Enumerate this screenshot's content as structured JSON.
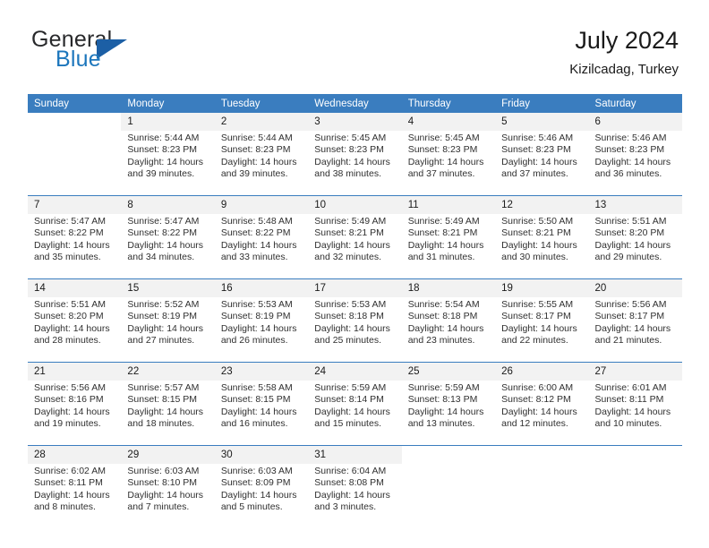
{
  "brand": {
    "word_one": "General",
    "word_two": "Blue",
    "logo_icon": "blue-triangle-icon"
  },
  "header": {
    "title": "July 2024",
    "subtitle": "Kizilcadag, Turkey"
  },
  "colors": {
    "header_blue": "#3a7dbf",
    "brand_blue": "#1c76bc",
    "logo_triangle": "#1c5fa5",
    "daynum_bg": "#f2f2f2",
    "text": "#1a1a1a"
  },
  "weekday_headers": [
    "Sunday",
    "Monday",
    "Tuesday",
    "Wednesday",
    "Thursday",
    "Friday",
    "Saturday"
  ],
  "weeks": [
    {
      "days": [
        {
          "num": "",
          "lines": []
        },
        {
          "num": "1",
          "lines": [
            "Sunrise: 5:44 AM",
            "Sunset: 8:23 PM",
            "Daylight: 14 hours",
            "and 39 minutes."
          ]
        },
        {
          "num": "2",
          "lines": [
            "Sunrise: 5:44 AM",
            "Sunset: 8:23 PM",
            "Daylight: 14 hours",
            "and 39 minutes."
          ]
        },
        {
          "num": "3",
          "lines": [
            "Sunrise: 5:45 AM",
            "Sunset: 8:23 PM",
            "Daylight: 14 hours",
            "and 38 minutes."
          ]
        },
        {
          "num": "4",
          "lines": [
            "Sunrise: 5:45 AM",
            "Sunset: 8:23 PM",
            "Daylight: 14 hours",
            "and 37 minutes."
          ]
        },
        {
          "num": "5",
          "lines": [
            "Sunrise: 5:46 AM",
            "Sunset: 8:23 PM",
            "Daylight: 14 hours",
            "and 37 minutes."
          ]
        },
        {
          "num": "6",
          "lines": [
            "Sunrise: 5:46 AM",
            "Sunset: 8:23 PM",
            "Daylight: 14 hours",
            "and 36 minutes."
          ]
        }
      ]
    },
    {
      "days": [
        {
          "num": "7",
          "lines": [
            "Sunrise: 5:47 AM",
            "Sunset: 8:22 PM",
            "Daylight: 14 hours",
            "and 35 minutes."
          ]
        },
        {
          "num": "8",
          "lines": [
            "Sunrise: 5:47 AM",
            "Sunset: 8:22 PM",
            "Daylight: 14 hours",
            "and 34 minutes."
          ]
        },
        {
          "num": "9",
          "lines": [
            "Sunrise: 5:48 AM",
            "Sunset: 8:22 PM",
            "Daylight: 14 hours",
            "and 33 minutes."
          ]
        },
        {
          "num": "10",
          "lines": [
            "Sunrise: 5:49 AM",
            "Sunset: 8:21 PM",
            "Daylight: 14 hours",
            "and 32 minutes."
          ]
        },
        {
          "num": "11",
          "lines": [
            "Sunrise: 5:49 AM",
            "Sunset: 8:21 PM",
            "Daylight: 14 hours",
            "and 31 minutes."
          ]
        },
        {
          "num": "12",
          "lines": [
            "Sunrise: 5:50 AM",
            "Sunset: 8:21 PM",
            "Daylight: 14 hours",
            "and 30 minutes."
          ]
        },
        {
          "num": "13",
          "lines": [
            "Sunrise: 5:51 AM",
            "Sunset: 8:20 PM",
            "Daylight: 14 hours",
            "and 29 minutes."
          ]
        }
      ]
    },
    {
      "days": [
        {
          "num": "14",
          "lines": [
            "Sunrise: 5:51 AM",
            "Sunset: 8:20 PM",
            "Daylight: 14 hours",
            "and 28 minutes."
          ]
        },
        {
          "num": "15",
          "lines": [
            "Sunrise: 5:52 AM",
            "Sunset: 8:19 PM",
            "Daylight: 14 hours",
            "and 27 minutes."
          ]
        },
        {
          "num": "16",
          "lines": [
            "Sunrise: 5:53 AM",
            "Sunset: 8:19 PM",
            "Daylight: 14 hours",
            "and 26 minutes."
          ]
        },
        {
          "num": "17",
          "lines": [
            "Sunrise: 5:53 AM",
            "Sunset: 8:18 PM",
            "Daylight: 14 hours",
            "and 25 minutes."
          ]
        },
        {
          "num": "18",
          "lines": [
            "Sunrise: 5:54 AM",
            "Sunset: 8:18 PM",
            "Daylight: 14 hours",
            "and 23 minutes."
          ]
        },
        {
          "num": "19",
          "lines": [
            "Sunrise: 5:55 AM",
            "Sunset: 8:17 PM",
            "Daylight: 14 hours",
            "and 22 minutes."
          ]
        },
        {
          "num": "20",
          "lines": [
            "Sunrise: 5:56 AM",
            "Sunset: 8:17 PM",
            "Daylight: 14 hours",
            "and 21 minutes."
          ]
        }
      ]
    },
    {
      "days": [
        {
          "num": "21",
          "lines": [
            "Sunrise: 5:56 AM",
            "Sunset: 8:16 PM",
            "Daylight: 14 hours",
            "and 19 minutes."
          ]
        },
        {
          "num": "22",
          "lines": [
            "Sunrise: 5:57 AM",
            "Sunset: 8:15 PM",
            "Daylight: 14 hours",
            "and 18 minutes."
          ]
        },
        {
          "num": "23",
          "lines": [
            "Sunrise: 5:58 AM",
            "Sunset: 8:15 PM",
            "Daylight: 14 hours",
            "and 16 minutes."
          ]
        },
        {
          "num": "24",
          "lines": [
            "Sunrise: 5:59 AM",
            "Sunset: 8:14 PM",
            "Daylight: 14 hours",
            "and 15 minutes."
          ]
        },
        {
          "num": "25",
          "lines": [
            "Sunrise: 5:59 AM",
            "Sunset: 8:13 PM",
            "Daylight: 14 hours",
            "and 13 minutes."
          ]
        },
        {
          "num": "26",
          "lines": [
            "Sunrise: 6:00 AM",
            "Sunset: 8:12 PM",
            "Daylight: 14 hours",
            "and 12 minutes."
          ]
        },
        {
          "num": "27",
          "lines": [
            "Sunrise: 6:01 AM",
            "Sunset: 8:11 PM",
            "Daylight: 14 hours",
            "and 10 minutes."
          ]
        }
      ]
    },
    {
      "days": [
        {
          "num": "28",
          "lines": [
            "Sunrise: 6:02 AM",
            "Sunset: 8:11 PM",
            "Daylight: 14 hours",
            "and 8 minutes."
          ]
        },
        {
          "num": "29",
          "lines": [
            "Sunrise: 6:03 AM",
            "Sunset: 8:10 PM",
            "Daylight: 14 hours",
            "and 7 minutes."
          ]
        },
        {
          "num": "30",
          "lines": [
            "Sunrise: 6:03 AM",
            "Sunset: 8:09 PM",
            "Daylight: 14 hours",
            "and 5 minutes."
          ]
        },
        {
          "num": "31",
          "lines": [
            "Sunrise: 6:04 AM",
            "Sunset: 8:08 PM",
            "Daylight: 14 hours",
            "and 3 minutes."
          ]
        },
        {
          "num": "",
          "lines": []
        },
        {
          "num": "",
          "lines": []
        },
        {
          "num": "",
          "lines": []
        }
      ]
    }
  ]
}
